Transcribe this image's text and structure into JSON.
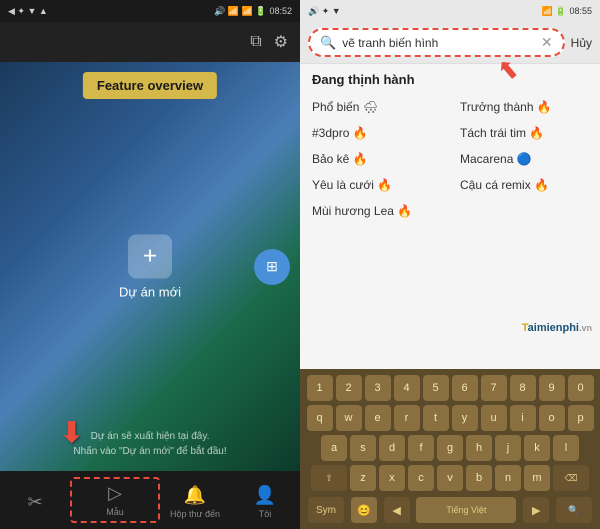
{
  "left": {
    "status": {
      "time": "08:52",
      "battery": "39%",
      "icons": "◀ ▲ ▼ ✦ ⊕"
    },
    "feature_banner": "Feature overview",
    "new_project_label": "Dự án mới",
    "bottom_text_line1": "Dự án sẽ xuất hiện tại đây.",
    "bottom_text_line2": "Nhấn vào \"Dự án mới\" để bắt đầu!",
    "nav": [
      {
        "id": "scissors",
        "icon": "✂",
        "label": ""
      },
      {
        "id": "mau",
        "icon": "▷",
        "label": "Mẫu"
      },
      {
        "id": "inbox",
        "icon": "🔔",
        "label": "Hộp thư đến"
      },
      {
        "id": "profile",
        "icon": "👤",
        "label": "Tôi"
      }
    ]
  },
  "right": {
    "status": {
      "time": "08:55",
      "battery": "38%"
    },
    "search": {
      "placeholder": "vẽ tranh biến hình",
      "cancel_label": "Hủy"
    },
    "trending": {
      "title": "Đang thịnh hành",
      "items": [
        {
          "text": "Phổ biến 🌨",
          "col": 1
        },
        {
          "text": "Trưởng thành 🔥",
          "col": 2
        },
        {
          "text": "#3dpro 🔥",
          "col": 1
        },
        {
          "text": "Tách trái tim 🔥",
          "col": 2
        },
        {
          "text": "Bảo kê 🔥",
          "col": 1
        },
        {
          "text": "Macarena 🔵",
          "col": 2
        },
        {
          "text": "Yêu là cưới 🔥",
          "col": 1
        },
        {
          "text": "Cậu cá remix 🔥",
          "col": 2
        },
        {
          "text": "Mùi hương Lea 🔥",
          "col": 1
        }
      ]
    },
    "keyboard": {
      "rows": [
        [
          "1",
          "2",
          "3",
          "4",
          "5",
          "6",
          "7",
          "8",
          "9",
          "0"
        ],
        [
          "q",
          "w",
          "e",
          "r",
          "t",
          "y",
          "u",
          "i",
          "o",
          "p"
        ],
        [
          "a",
          "s",
          "d",
          "f",
          "g",
          "h",
          "j",
          "k",
          "l"
        ],
        [
          "⇧",
          "z",
          "x",
          "c",
          "v",
          "b",
          "n",
          "m",
          "⌫"
        ],
        [
          "Sym",
          "😊",
          "◀",
          "Tiếng Việt",
          "▶",
          "🔍"
        ]
      ]
    }
  }
}
